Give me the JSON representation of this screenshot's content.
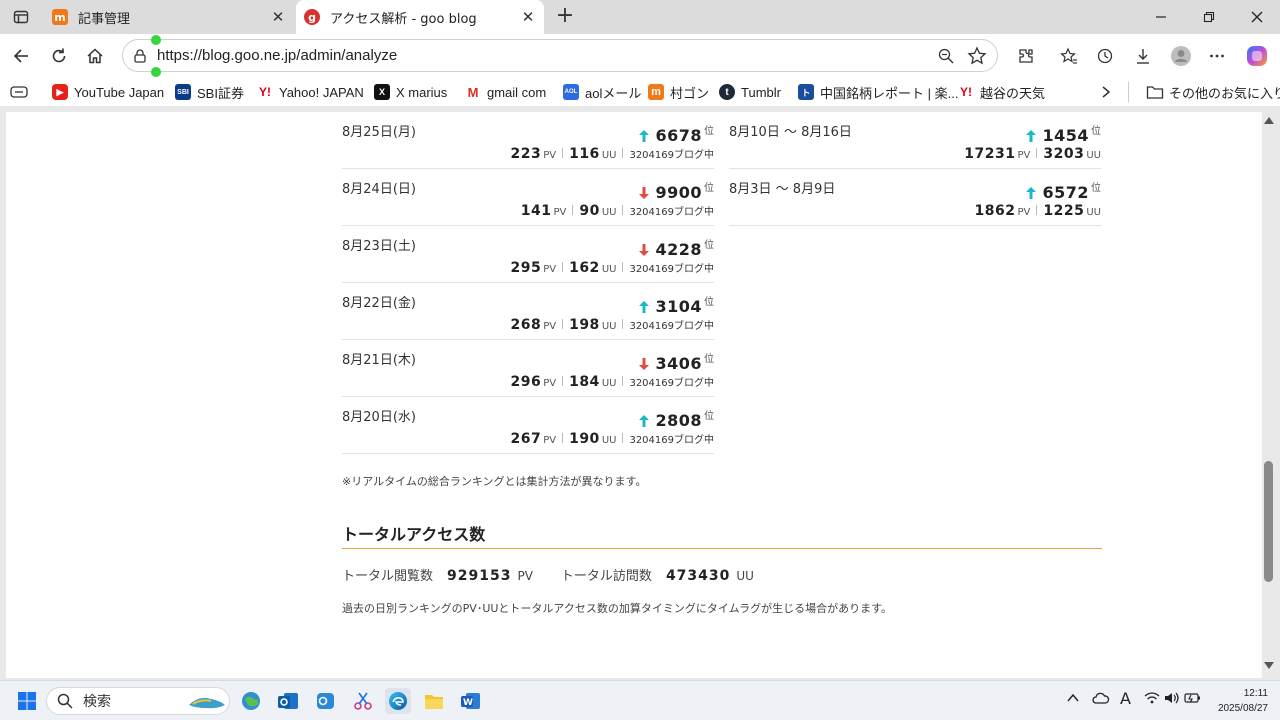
{
  "browser": {
    "tabs": [
      {
        "label": "記事管理",
        "favicon_text": "m"
      },
      {
        "label": "アクセス解析 - goo blog",
        "favicon_text": "g"
      }
    ],
    "url": "https://blog.goo.ne.jp/admin/analyze",
    "bookmarks": [
      {
        "label": "YouTube Japan",
        "icon": "youtube-icon",
        "icon_text": "▶"
      },
      {
        "label": "SBI証券",
        "icon": "sbi-icon",
        "icon_text": "SBI"
      },
      {
        "label": "Yahoo! JAPAN",
        "icon": "yahoo-icon",
        "icon_text": "Y!"
      },
      {
        "label": "X marius",
        "icon": "x-icon",
        "icon_text": "X"
      },
      {
        "label": "gmail com",
        "icon": "gmail-icon",
        "icon_text": "M"
      },
      {
        "label": "aolメール",
        "icon": "aol-icon",
        "icon_text": "AOL"
      },
      {
        "label": "村ゴン",
        "icon": "mura-icon",
        "icon_text": "m"
      },
      {
        "label": "Tumblr",
        "icon": "tumblr-icon",
        "icon_text": "t"
      },
      {
        "label": "中国銘柄レポート | 楽...",
        "icon": "report-icon",
        "icon_text": "ト"
      },
      {
        "label": "越谷の天気",
        "icon": "yahoo-icon",
        "icon_text": "Y!"
      }
    ],
    "other_favorites": "その他のお気に入り"
  },
  "daily": [
    {
      "date": "8月25日(月)",
      "trend": "up",
      "rank": "6678",
      "pv": "223",
      "uu": "116",
      "blogs": "3204169ブログ中"
    },
    {
      "date": "8月24日(日)",
      "trend": "down",
      "rank": "9900",
      "pv": "141",
      "uu": "90",
      "blogs": "3204169ブログ中"
    },
    {
      "date": "8月23日(土)",
      "trend": "down",
      "rank": "4228",
      "pv": "295",
      "uu": "162",
      "blogs": "3204169ブログ中"
    },
    {
      "date": "8月22日(金)",
      "trend": "up",
      "rank": "3104",
      "pv": "268",
      "uu": "198",
      "blogs": "3204169ブログ中"
    },
    {
      "date": "8月21日(木)",
      "trend": "down",
      "rank": "3406",
      "pv": "296",
      "uu": "184",
      "blogs": "3204169ブログ中"
    },
    {
      "date": "8月20日(水)",
      "trend": "up",
      "rank": "2808",
      "pv": "267",
      "uu": "190",
      "blogs": "3204169ブログ中"
    }
  ],
  "weekly": [
    {
      "date": "8月10日 〜 8月16日",
      "trend": "up",
      "rank": "1454",
      "pv": "17231",
      "uu": "3203"
    },
    {
      "date": "8月3日 〜 8月9日",
      "trend": "up",
      "rank": "6572",
      "pv": "1862",
      "uu": "1225"
    }
  ],
  "labels": {
    "rank_unit": "位",
    "pv_unit": "PV",
    "uu_unit": "UU"
  },
  "note_realtime": "※リアルタイムの総合ランキングとは集計方法が異なります。",
  "total": {
    "title": "トータルアクセス数",
    "views_label": "トータル閲覧数",
    "views_value": "929153",
    "views_unit": "PV",
    "visits_label": "トータル訪問数",
    "visits_value": "473430",
    "visits_unit": "UU",
    "note": "過去の日別ランキングのPV･UUとトータルアクセス数の加算タイミングにタイムラグが生じる場合があります。"
  },
  "colors": {
    "up": "#19b8c8",
    "down": "#e04a3f",
    "accent_line": "#e5a043"
  },
  "taskbar": {
    "search_placeholder": "検索",
    "time": "12:11",
    "date": "2025/08/27"
  }
}
